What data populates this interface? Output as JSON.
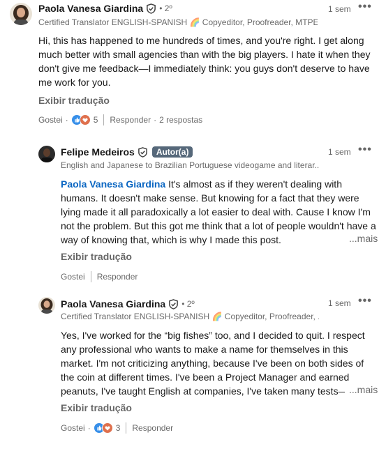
{
  "comments": [
    {
      "name": "Paola Vanesa Giardina",
      "degree": "• 2º",
      "headline": "Certified Translator ENGLISH-SPANISH 🌈 Copyeditor, Proofreader, MTPE...",
      "time": "1 sem",
      "more": "•••",
      "text": "Hi, this has happened to me hundreds of times, and you're right. I get along much better with small agencies than with the big players. I hate it when they don't give me feedback—I immediately think: you guys don't deserve to have me work for you.",
      "translate": "Exibir tradução",
      "like": "Gostei",
      "reaction_count": "5",
      "reply": "Responder",
      "replies": "2 respostas"
    },
    {
      "name": "Felipe Medeiros",
      "badge": "Autor(a)",
      "headline": "English and Japanese to Brazilian Portuguese videogame and literar...",
      "time": "1 sem",
      "more": "•••",
      "mention": "Paola Vanesa Giardina",
      "text": " It's almost as if they weren't dealing with humans. It doesn't make sense. But knowing for a fact that they were lying made it all paradoxically a lot easier to deal with. Cause I know I'm not the problem. But this got me think that a lot of people wouldn't have a way of knowing that, which is why I made this post.",
      "see_more": "...mais",
      "translate": "Exibir tradução",
      "like": "Gostei",
      "reply": "Responder"
    },
    {
      "name": "Paola Vanesa Giardina",
      "degree": "• 2º",
      "headline": "Certified Translator ENGLISH-SPANISH 🌈 Copyeditor, Proofreader, ...",
      "time": "1 sem",
      "more": "•••",
      "text": "Yes, I've worked for the “big fishes” too, and I decided to quit. I respect any professional who wants to make a name for themselves in this market. I'm not criticizing anything, because I've been on both sides of the coin at different times. I've been a Project Manager and earned peanuts, I've taught English at companies, I've taken many tests—",
      "see_more": "...mais",
      "translate": "Exibir tradução",
      "like": "Gostei",
      "reaction_count": "3",
      "reply": "Responder"
    }
  ],
  "icons": {
    "verified": "verified-shield-icon",
    "like_reaction": "like-reaction-icon",
    "love_reaction": "love-reaction-icon",
    "more": "more-options-icon"
  },
  "colors": {
    "mention": "#0a66c2",
    "badge_bg": "#56687a",
    "like_blue": "#378fe9",
    "love_red": "#df704d"
  }
}
